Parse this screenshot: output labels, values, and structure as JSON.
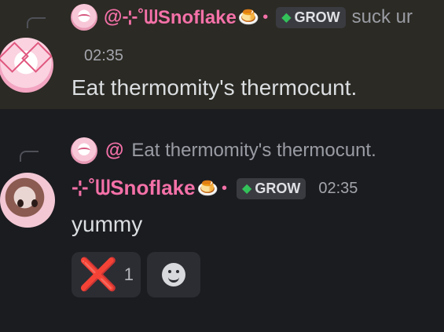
{
  "message1": {
    "reply": {
      "at": "@",
      "username": "⊹˚ᗯSnoflake",
      "flan_icon": "flan-pudding-icon",
      "tag": "GROW",
      "tag_icon": "leaf-icon",
      "preview": "suck ur"
    },
    "time": "02:35",
    "text": "Eat thermomity's thermocunt."
  },
  "message2": {
    "reply": {
      "at": "@",
      "preview": "Eat thermomity's thermocunt."
    },
    "username": "⊹˚ᗯSnoflake",
    "flan_icon": "flan-pudding-icon",
    "tag": "GROW",
    "tag_icon": "leaf-icon",
    "time": "02:35",
    "text": "yummy",
    "reactions": [
      {
        "emoji": "❌",
        "count": "1"
      },
      {
        "icon": "add-reaction-smiley-icon"
      }
    ]
  },
  "colors": {
    "accent_pink": "#f471a8",
    "highlight_bg": "#2b2a24",
    "bg": "#1b1c20",
    "tag_green": "#33c25a"
  }
}
